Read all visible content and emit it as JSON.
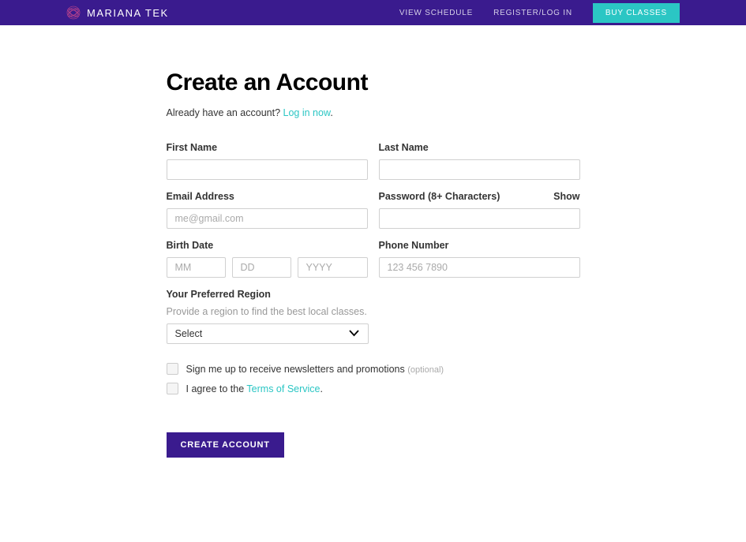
{
  "header": {
    "brand": "MARIANA TEK",
    "nav": {
      "view_schedule": "VIEW SCHEDULE",
      "register_login": "REGISTER/LOG IN",
      "buy_classes": "BUY CLASSES"
    }
  },
  "page": {
    "title": "Create an Account",
    "subtitle_prefix": "Already have an account? ",
    "login_link": "Log in now",
    "subtitle_suffix": "."
  },
  "form": {
    "first_name_label": "First Name",
    "last_name_label": "Last Name",
    "email_label": "Email Address",
    "email_placeholder": "me@gmail.com",
    "password_label": "Password (8+ Characters)",
    "password_toggle": "Show",
    "birth_label": "Birth Date",
    "birth_mm_placeholder": "MM",
    "birth_dd_placeholder": "DD",
    "birth_yyyy_placeholder": "YYYY",
    "phone_label": "Phone Number",
    "phone_placeholder": "123 456 7890",
    "region_label": "Your Preferred Region",
    "region_hint": "Provide a region to find the best local classes.",
    "region_placeholder": "Select",
    "newsletter_label": "Sign me up to receive newsletters and promotions ",
    "newsletter_optional": "(optional)",
    "tos_prefix": "I agree to the ",
    "tos_link": "Terms of Service",
    "tos_suffix": ".",
    "submit": "CREATE ACCOUNT"
  }
}
